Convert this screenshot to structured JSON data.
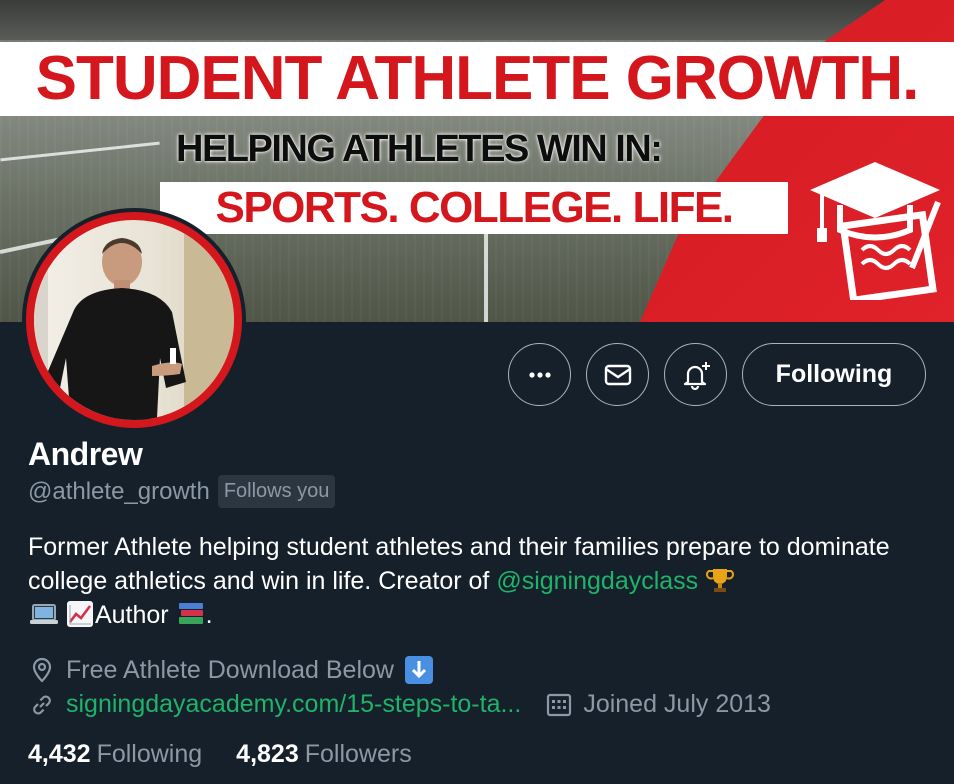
{
  "banner": {
    "headline": "STUDENT ATHLETE GROWTH.",
    "subline": "HELPING ATHLETES WIN IN:",
    "tagline": "SPORTS. COLLEGE. LIFE."
  },
  "profile": {
    "name": "Andrew",
    "handle": "@athlete_growth",
    "follows_you": "Follows you",
    "bio_part1": "Former Athlete helping student athletes and their families prepare to dominate college athletics and win in life. Creator of ",
    "bio_mention": "@signingdayclass",
    "bio_author": "Author",
    "bio_end": ".",
    "location": "Free Athlete Download Below",
    "website": "signingdayacademy.com/15-steps-to-ta...",
    "joined": "Joined July 2013"
  },
  "actions": {
    "more_icon": "more-icon",
    "message_icon": "envelope-icon",
    "notify_icon": "bell-plus-icon",
    "following_label": "Following"
  },
  "stats": {
    "following_count": "4,432",
    "following_label": "Following",
    "followers_count": "4,823",
    "followers_label": "Followers"
  },
  "colors": {
    "background": "#15202b",
    "accent_green": "#1fb36a",
    "muted": "#8b98a5",
    "brand_red": "#d4161d"
  }
}
